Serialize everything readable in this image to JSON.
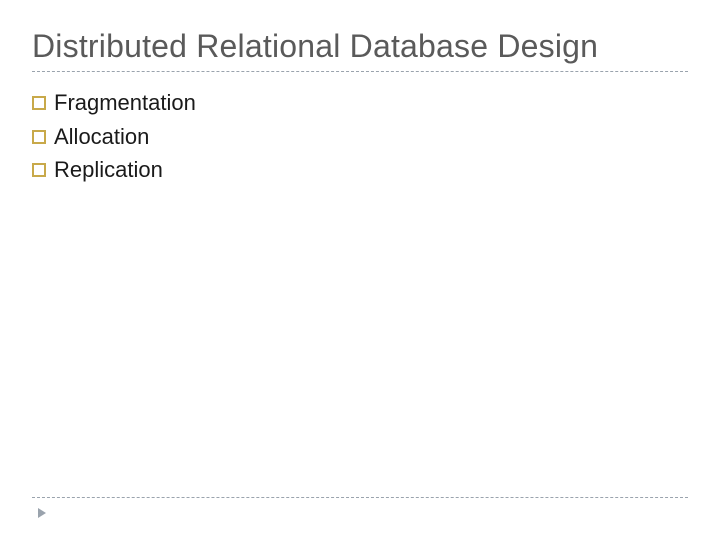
{
  "title": "Distributed Relational Database Design",
  "bullets": [
    {
      "label": "Fragmentation"
    },
    {
      "label": "Allocation"
    },
    {
      "label": "Replication"
    }
  ],
  "colors": {
    "title_text": "#5a5a5a",
    "divider": "#9aa3ad",
    "bullet_border": "#c8a94a",
    "body_text": "#1a1a1a"
  }
}
